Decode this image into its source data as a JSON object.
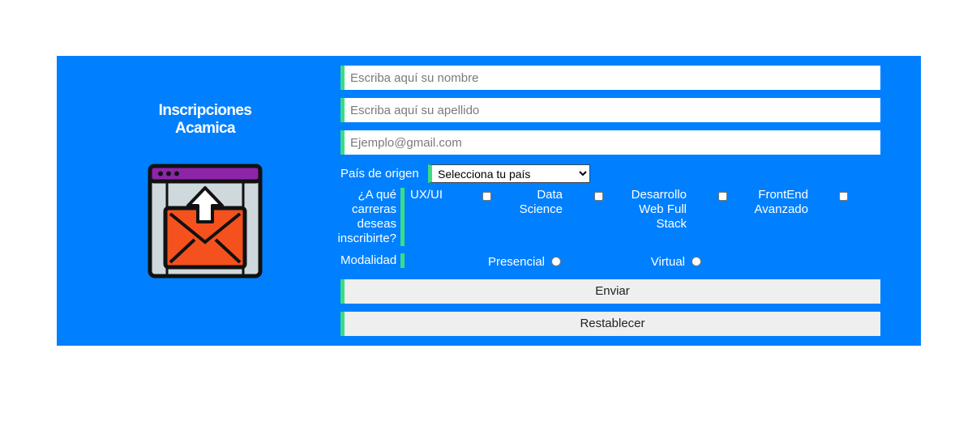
{
  "form": {
    "title": "Inscripciones Acamica",
    "nombre_placeholder": "Escriba aquí su nombre",
    "apellido_placeholder": "Escriba aquí su apellido",
    "email_placeholder": "Ejemplo@gmail.com",
    "pais_label": "País de origen",
    "pais_selected": "Selecciona tu país",
    "carreras_label": "¿A qué carreras deseas inscribirte?",
    "carreras": [
      {
        "label": "UX/UI",
        "checked": false
      },
      {
        "label": "Data Science",
        "checked": false
      },
      {
        "label": "Desarrollo Web Full Stack",
        "checked": false
      },
      {
        "label": "FrontEnd Avanzado",
        "checked": false
      }
    ],
    "modalidad_label": "Modalidad",
    "modalidades": [
      {
        "label": "Presencial",
        "selected": false
      },
      {
        "label": "Virtual",
        "selected": false
      }
    ],
    "enviar_label": "Enviar",
    "restablecer_label": "Restablecer"
  },
  "icon": {
    "name": "email-upload-icon"
  },
  "colors": {
    "panel": "#0080ff",
    "accent": "#3ddc84",
    "button": "#efefef",
    "envelope": "#f4511e",
    "window_bar": "#8e24aa"
  }
}
